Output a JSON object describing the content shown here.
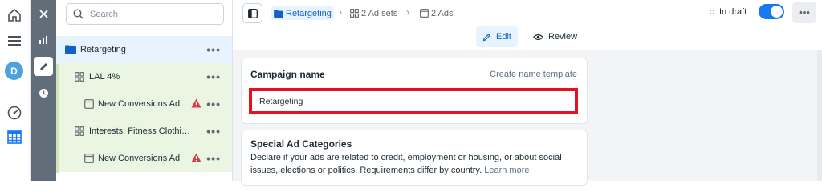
{
  "search": {
    "placeholder": "Search"
  },
  "tree": {
    "items": [
      {
        "label": "Retargeting",
        "level": "campaign",
        "selected": true,
        "warning": false
      },
      {
        "label": "LAL 4%",
        "level": "ad-set",
        "selected": false,
        "warning": false
      },
      {
        "label": "New Conversions Ad",
        "level": "ad",
        "selected": false,
        "warning": true
      },
      {
        "label": "Interests: Fitness Clothing ...",
        "level": "ad-set",
        "selected": false,
        "warning": false
      },
      {
        "label": "New Conversions Ad",
        "level": "ad",
        "selected": false,
        "warning": true
      }
    ],
    "more_label": "•••"
  },
  "header": {
    "breadcrumbs": [
      {
        "label": "Retargeting",
        "icon": "folder-icon"
      },
      {
        "label": "2 Ad sets",
        "icon": "grid-icon"
      },
      {
        "label": "2 Ads",
        "icon": "ad-icon"
      }
    ],
    "status": "In draft",
    "more_label": "•••"
  },
  "modes": {
    "edit": "Edit",
    "review": "Review"
  },
  "campaign_card": {
    "title": "Campaign name",
    "template_link": "Create name template",
    "name_value": "Retargeting"
  },
  "special_card": {
    "title": "Special Ad Categories",
    "description": "Declare if your ads are related to credit, employment or housing, or about social issues, elections or politics. Requirements differ by country.",
    "learn_more": "Learn more"
  },
  "nav": {
    "avatar_initial": "D"
  },
  "colors": {
    "accent": "#1877f2",
    "highlight": "#e8101c",
    "warning": "#e0353b",
    "selected_bg": "#e7f3ff",
    "adset_bg": "#eaf5e2"
  }
}
